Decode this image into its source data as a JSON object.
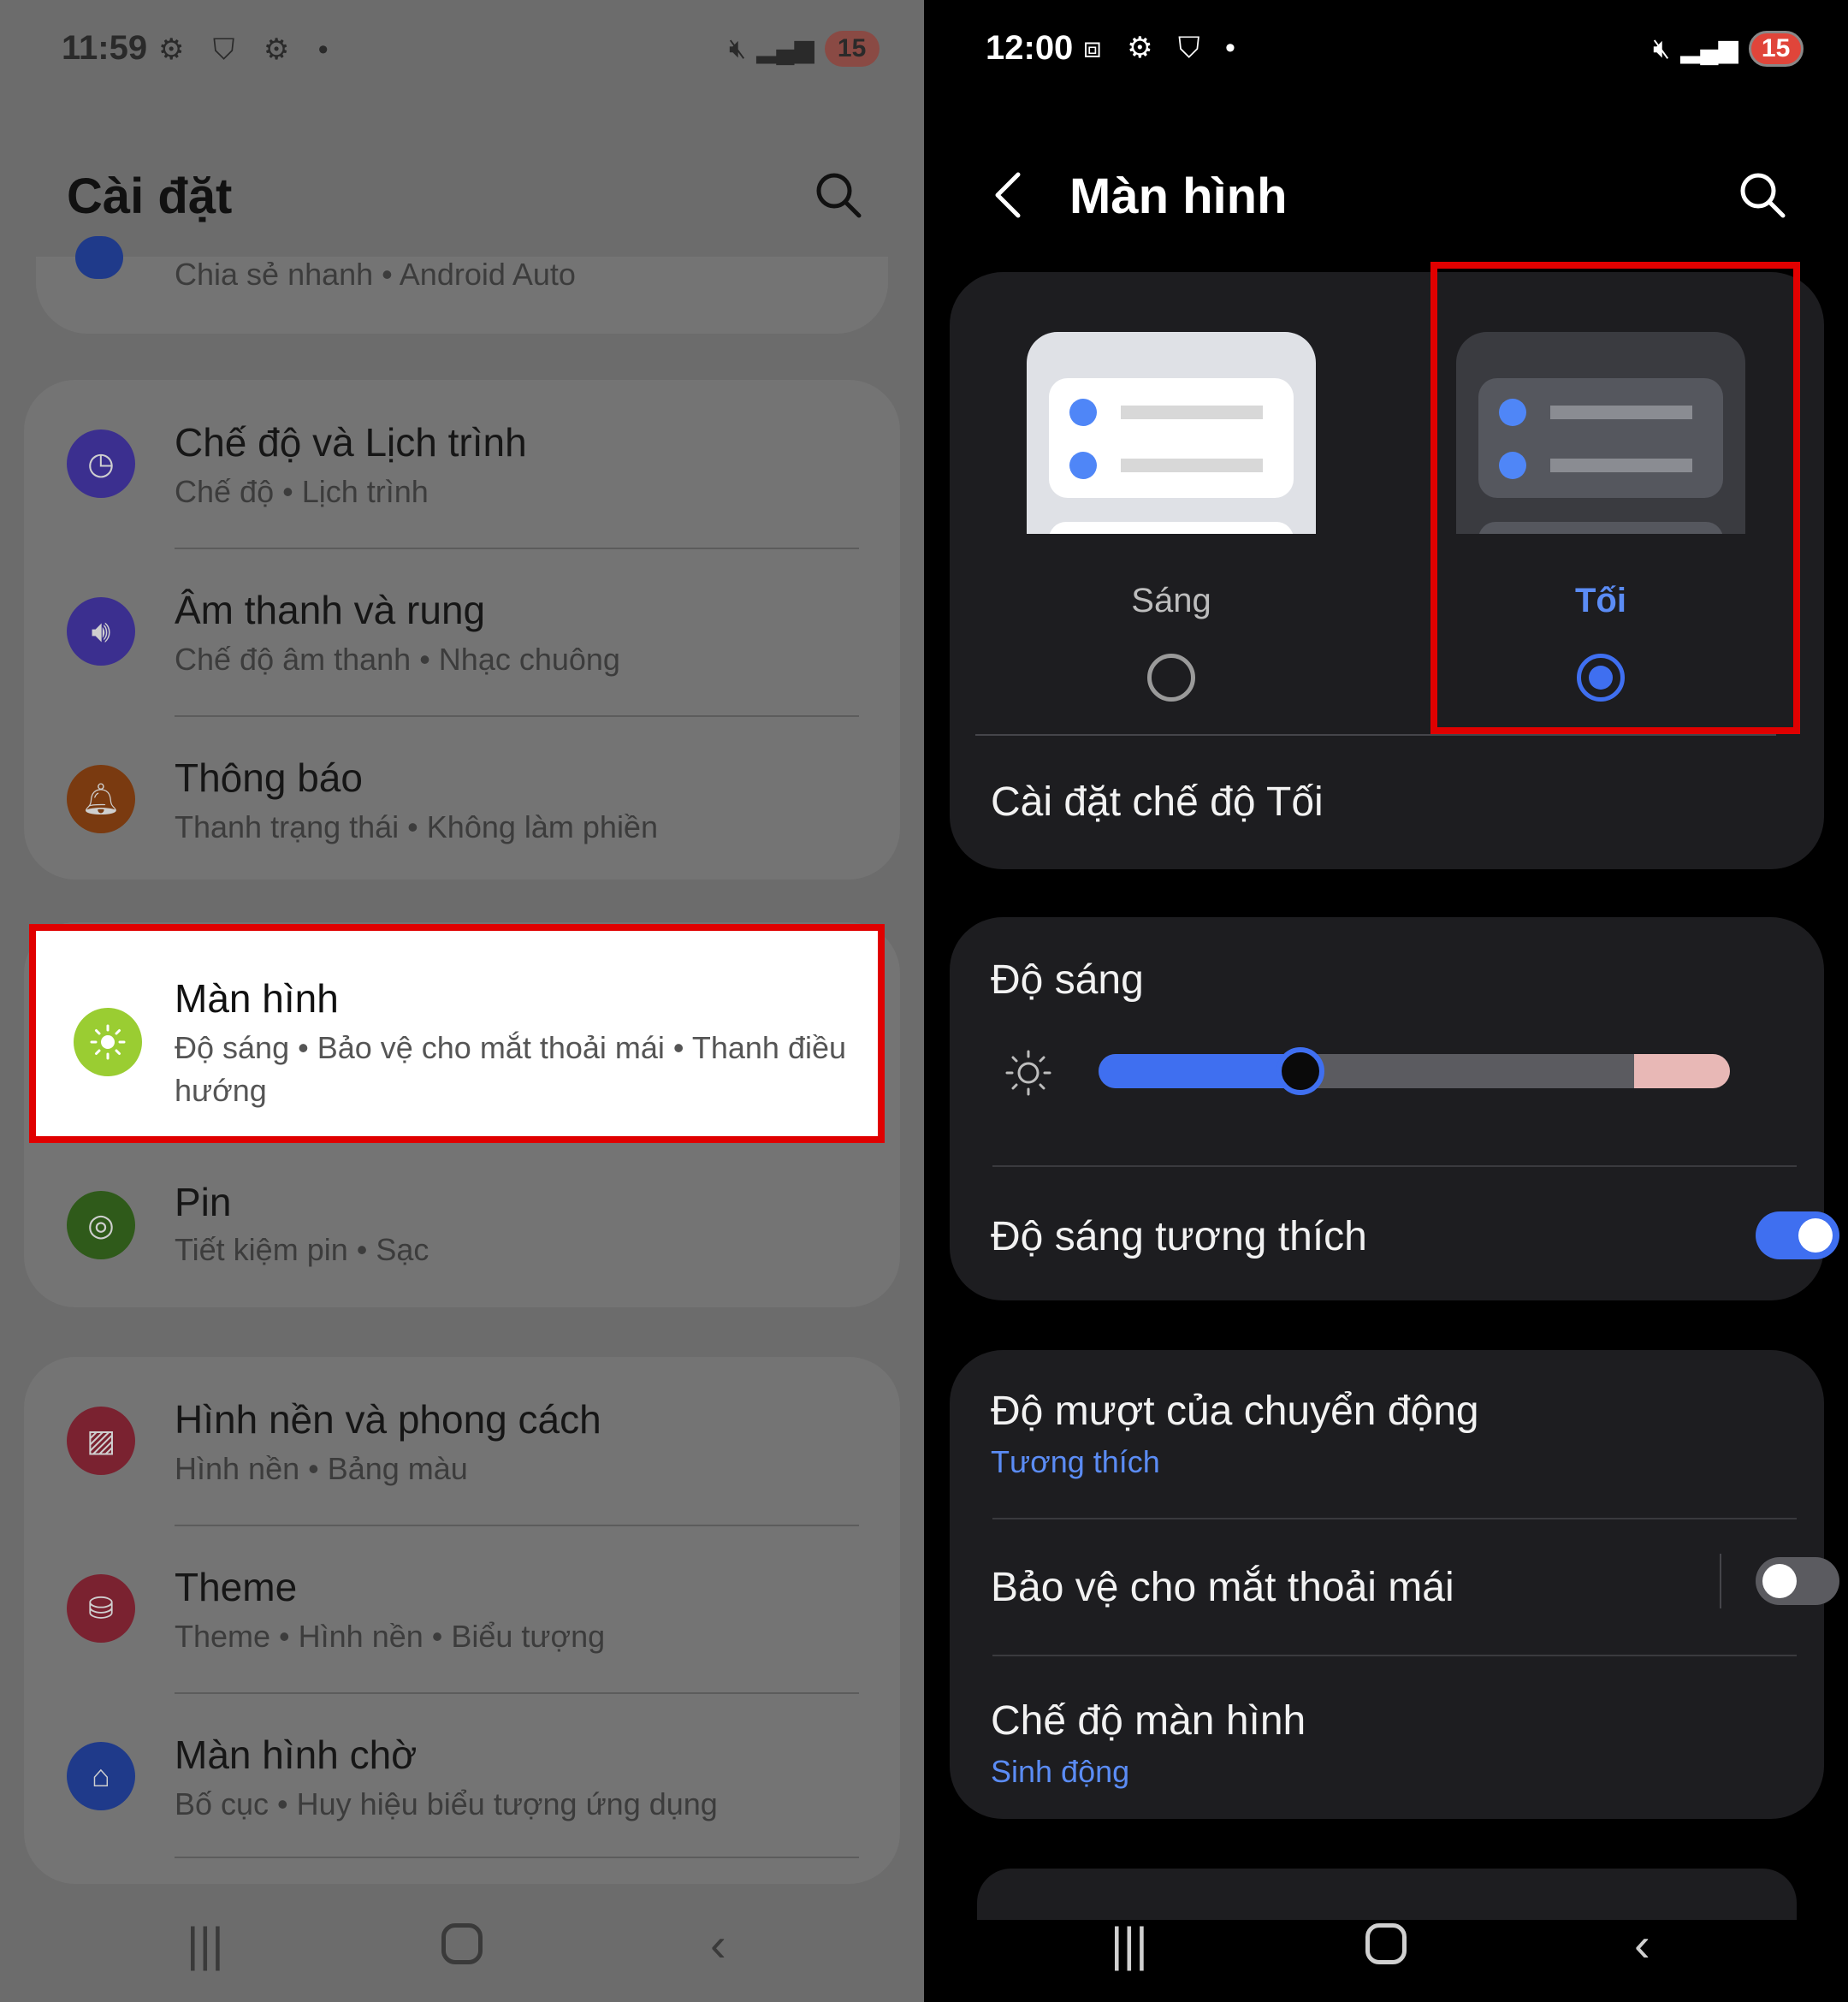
{
  "left": {
    "status": {
      "time": "11:59",
      "battery": "15"
    },
    "title": "Cài đặt",
    "partial_item_sub": "Chia sẻ nhanh • Android Auto",
    "group1": [
      {
        "title": "Chế độ và Lịch trình",
        "sub": "Chế độ • Lịch trình",
        "icon": "modes-icon",
        "color": "#3b2f8f"
      },
      {
        "title": "Âm thanh và rung",
        "sub": "Chế độ âm thanh • Nhạc chuông",
        "icon": "volume-icon",
        "color": "#3b2f8f"
      },
      {
        "title": "Thông báo",
        "sub": "Thanh trạng thái • Không làm phiền",
        "icon": "bell-icon",
        "color": "#7a3a10"
      }
    ],
    "highlighted": {
      "title": "Màn hình",
      "sub": "Độ sáng • Bảo vệ cho mắt thoải mái • Thanh điều hướng",
      "icon": "sun-icon",
      "color": "#9acd32"
    },
    "battery_item": {
      "title": "Pin",
      "sub": "Tiết kiệm pin • Sạc",
      "icon": "battery-icon",
      "color": "#2f5a1a"
    },
    "group3": [
      {
        "title": "Hình nền và phong cách",
        "sub": "Hình nền • Bảng màu",
        "icon": "wallpaper-icon",
        "color": "#7a2230"
      },
      {
        "title": "Theme",
        "sub": "Theme • Hình nền • Biểu tượng",
        "icon": "theme-icon",
        "color": "#7a2230"
      },
      {
        "title": "Màn hình chờ",
        "sub": "Bố cục • Huy hiệu biểu tượng ứng dụng",
        "icon": "home-icon",
        "color": "#1f3a8a"
      }
    ]
  },
  "right": {
    "status": {
      "time": "12:00",
      "battery": "15"
    },
    "title": "Màn hình",
    "modes": {
      "light_label": "Sáng",
      "dark_label": "Tối",
      "selected": "dark"
    },
    "dark_mode_settings": "Cài đặt chế độ Tối",
    "brightness": {
      "label": "Độ sáng",
      "level": 0.32
    },
    "adaptive_brightness": {
      "label": "Độ sáng tương thích",
      "on": true
    },
    "motion_smoothness": {
      "label": "Độ mượt của chuyển động",
      "value": "Tương thích"
    },
    "eye_comfort": {
      "label": "Bảo vệ cho mắt thoải mái",
      "on": false
    },
    "screen_mode": {
      "label": "Chế độ màn hình",
      "value": "Sinh động"
    },
    "accent": "#3f6ff0"
  }
}
